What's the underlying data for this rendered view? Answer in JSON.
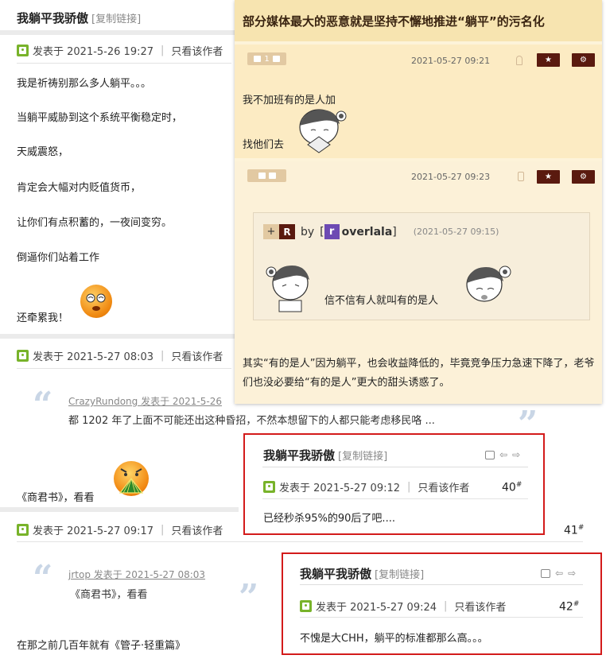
{
  "left": {
    "author": "我躺平我骄傲",
    "copy_link": "[复制链接]",
    "posts": [
      {
        "posted_at": "发表于 2021-5-26 19:27",
        "only_author": "只看该作者",
        "lines": [
          "我是祈祷别那么多人躺平。。。",
          "当躺平威胁到这个系统平衡稳定时，",
          "天威震怒，",
          "肯定会大幅对内贬值货币，",
          "让你们有点积蓄的，一夜间变穷。",
          "倒逼你们站着工作",
          "还牵累我！"
        ]
      },
      {
        "posted_at": "发表于 2021-5-27 08:03",
        "only_author": "只看该作者",
        "quote_author": "CrazyRundong 发表于 2021-5-26",
        "quote_text": "都 1202 年了上面不可能还出这种昏招，不然本想留下的人都只能考虑移民咯 ...",
        "reply": "《商君书》，看看"
      },
      {
        "posted_at": "发表于 2021-5-27 09:17",
        "only_author": "只看该作者",
        "floor": "41",
        "quote_author": "jrtop 发表于 2021-5-27 08:03",
        "quote_text": "《商君书》，看看",
        "reply": "在那之前几百年就有《管子·轻重篇》"
      }
    ]
  },
  "panel": {
    "title": "部分媒体最大的恶意就是坚持不懈地推进“躺平”的污名化",
    "reply1": {
      "votes": "1",
      "time": "2021-05-27 09:21",
      "text1": "我不加班有的是人加",
      "text2": "找他们去"
    },
    "reply2": {
      "time": "2021-05-27 09:23",
      "quote": {
        "plus": "+",
        "r": "R",
        "by": "by",
        "user_initial": "r",
        "user": "overlala",
        "time": "(2021-05-27 09:15)",
        "text": "信不信有人就叫有的是人"
      },
      "text": "其实“有的是人”因为躺平，也会收益降低的，毕竟竞争压力急速下降了，老爷们也没必要给“有的是人”更大的甜头诱惑了。"
    }
  },
  "popup1": {
    "author": "我躺平我骄傲",
    "copy_link": "[复制链接]",
    "posted_at": "发表于 2021-5-27 09:12",
    "only_author": "只看该作者",
    "floor": "40",
    "text": "已经秒杀95%的90后了吧...."
  },
  "popup2": {
    "author": "我躺平我骄傲",
    "copy_link": "[复制链接]",
    "posted_at": "发表于 2021-5-27 09:24",
    "only_author": "只看该作者",
    "floor": "42",
    "text": "不愧是大CHH，躺平的标准都那么高。。。"
  }
}
